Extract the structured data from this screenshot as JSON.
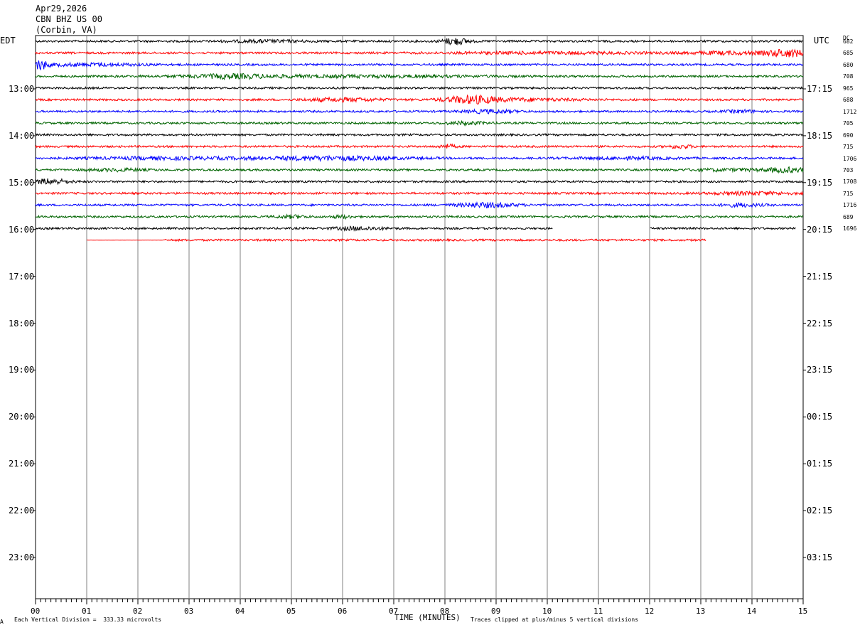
{
  "header": {
    "date": "Apr29,2026",
    "station": "CBN BHZ US 00",
    "location": "(Corbin, VA)"
  },
  "left_timezone": "EDT",
  "right_timezone": "UTC",
  "dc_label": "DC",
  "footer": {
    "scale_note": "Each Vertical Division =  333.33 microvolts",
    "clip_note": "Traces clipped at plus/minus 5 vertical divisions",
    "corner_mark": "A"
  },
  "colors": {
    "black": "#000000",
    "red": "#ff0000",
    "blue": "#0000ff",
    "green": "#006400",
    "grid": "#808080"
  },
  "chart_data": {
    "type": "line",
    "title": "",
    "xlabel": "TIME (MINUTES)",
    "ylabel": "",
    "xlim": [
      0,
      15
    ],
    "x_ticks": [
      "00",
      "01",
      "02",
      "03",
      "04",
      "05",
      "06",
      "07",
      "08",
      "09",
      "10",
      "11",
      "12",
      "13",
      "14",
      "15"
    ],
    "left_hour_labels": [
      "13:00",
      "14:00",
      "15:00",
      "16:00",
      "17:00",
      "18:00",
      "19:00",
      "20:00",
      "21:00",
      "22:00",
      "23:00"
    ],
    "right_hour_labels": [
      "17:15",
      "18:15",
      "19:15",
      "20:15",
      "21:15",
      "22:15",
      "23:15",
      "00:15",
      "01:15",
      "02:15",
      "03:15"
    ],
    "trace_colors": [
      "black",
      "red",
      "blue",
      "green"
    ],
    "traces": [
      {
        "dc": "682",
        "color": "black",
        "start": 0,
        "end": 15,
        "bursts": [
          [
            8.2,
            0.25,
            4.5
          ],
          [
            4.5,
            0.8,
            1.4
          ]
        ]
      },
      {
        "dc": "685",
        "color": "red",
        "start": 0,
        "end": 15,
        "bursts": [
          [
            14.7,
            0.4,
            5
          ],
          [
            13.5,
            0.8,
            1.8
          ],
          [
            10,
            2,
            1.2
          ]
        ]
      },
      {
        "dc": "680",
        "color": "blue",
        "start": 0,
        "end": 15,
        "bursts": [
          [
            0.1,
            0.12,
            6
          ],
          [
            1,
            1.2,
            1.6
          ]
        ]
      },
      {
        "dc": "708",
        "color": "green",
        "start": 0,
        "end": 15,
        "bursts": [
          [
            3.8,
            0.8,
            2
          ],
          [
            6,
            3,
            1.3
          ]
        ]
      },
      {
        "dc": "965",
        "color": "black",
        "start": 0,
        "end": 15,
        "bursts": []
      },
      {
        "dc": "688",
        "color": "red",
        "start": 0,
        "end": 15,
        "bursts": [
          [
            8.5,
            0.5,
            4.5
          ],
          [
            6,
            0.7,
            2.2
          ],
          [
            9.5,
            1.2,
            1.6
          ]
        ]
      },
      {
        "dc": "1712",
        "color": "blue",
        "start": 0,
        "end": 15,
        "bursts": [
          [
            8.9,
            0.5,
            2.2
          ],
          [
            13.8,
            0.3,
            1.6
          ]
        ]
      },
      {
        "dc": "705",
        "color": "green",
        "start": 0,
        "end": 15,
        "bursts": [
          [
            8.4,
            0.4,
            1.8
          ]
        ]
      },
      {
        "dc": "690",
        "color": "black",
        "start": 0,
        "end": 15,
        "bursts": []
      },
      {
        "dc": "715",
        "color": "red",
        "start": 0,
        "end": 15,
        "bursts": [
          [
            8.05,
            0.15,
            2.6
          ],
          [
            12.6,
            0.25,
            2
          ]
        ]
      },
      {
        "dc": "1706",
        "color": "blue",
        "start": 0,
        "end": 15,
        "bursts": [
          [
            5.7,
            1.5,
            2.4
          ],
          [
            2.5,
            1.5,
            1.4
          ],
          [
            11.5,
            1,
            1.4
          ]
        ]
      },
      {
        "dc": "703",
        "color": "green",
        "start": 0,
        "end": 15,
        "bursts": [
          [
            14.7,
            0.4,
            3
          ],
          [
            1.6,
            0.6,
            1.5
          ],
          [
            13.5,
            0.8,
            1.3
          ]
        ]
      },
      {
        "dc": "1708",
        "color": "black",
        "start": 0,
        "end": 15,
        "bursts": [
          [
            0.3,
            0.35,
            3.5
          ]
        ]
      },
      {
        "dc": "715",
        "color": "red",
        "start": 0,
        "end": 15,
        "bursts": [
          [
            14,
            0.8,
            1.8
          ]
        ]
      },
      {
        "dc": "1716",
        "color": "blue",
        "start": 0,
        "end": 15,
        "bursts": [
          [
            8.8,
            0.6,
            2.8
          ],
          [
            13.8,
            0.4,
            2
          ]
        ]
      },
      {
        "dc": "689",
        "color": "green",
        "start": 0,
        "end": 15,
        "bursts": [
          [
            5,
            0.3,
            1.8
          ],
          [
            6,
            0.2,
            1.8
          ]
        ]
      },
      {
        "dc": "1696",
        "color": "black",
        "start": 0,
        "end": 14.85,
        "gap": [
          10.1,
          12.0
        ],
        "bursts": [
          [
            6.3,
            0.5,
            2
          ]
        ]
      },
      {
        "dc": "",
        "color": "red",
        "start": 1.0,
        "end": 13.1,
        "flat_until": 2.5,
        "bursts": []
      }
    ]
  }
}
